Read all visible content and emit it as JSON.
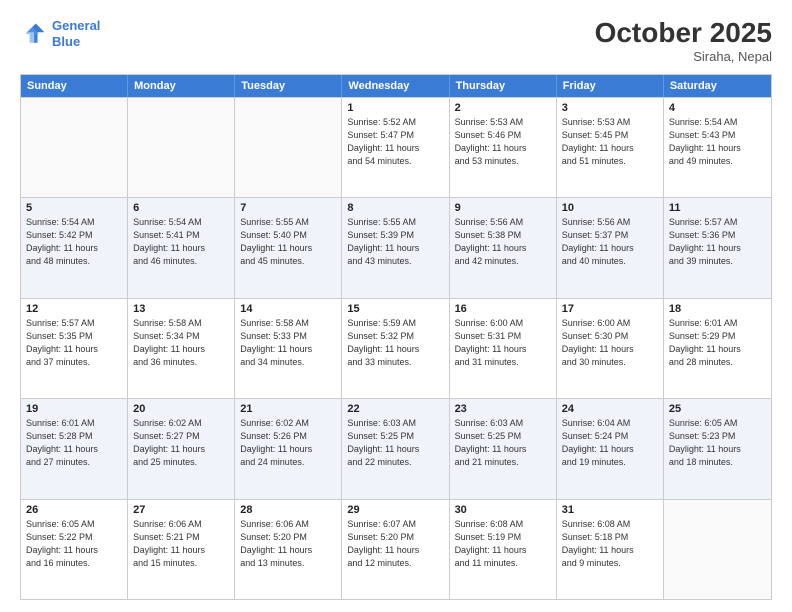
{
  "header": {
    "logo_line1": "General",
    "logo_line2": "Blue",
    "month": "October 2025",
    "location": "Siraha, Nepal"
  },
  "days_of_week": [
    "Sunday",
    "Monday",
    "Tuesday",
    "Wednesday",
    "Thursday",
    "Friday",
    "Saturday"
  ],
  "weeks": [
    [
      {
        "day": "",
        "text": "",
        "shaded": false
      },
      {
        "day": "",
        "text": "",
        "shaded": false
      },
      {
        "day": "",
        "text": "",
        "shaded": false
      },
      {
        "day": "1",
        "text": "Sunrise: 5:52 AM\nSunset: 5:47 PM\nDaylight: 11 hours\nand 54 minutes.",
        "shaded": false
      },
      {
        "day": "2",
        "text": "Sunrise: 5:53 AM\nSunset: 5:46 PM\nDaylight: 11 hours\nand 53 minutes.",
        "shaded": false
      },
      {
        "day": "3",
        "text": "Sunrise: 5:53 AM\nSunset: 5:45 PM\nDaylight: 11 hours\nand 51 minutes.",
        "shaded": false
      },
      {
        "day": "4",
        "text": "Sunrise: 5:54 AM\nSunset: 5:43 PM\nDaylight: 11 hours\nand 49 minutes.",
        "shaded": false
      }
    ],
    [
      {
        "day": "5",
        "text": "Sunrise: 5:54 AM\nSunset: 5:42 PM\nDaylight: 11 hours\nand 48 minutes.",
        "shaded": true
      },
      {
        "day": "6",
        "text": "Sunrise: 5:54 AM\nSunset: 5:41 PM\nDaylight: 11 hours\nand 46 minutes.",
        "shaded": true
      },
      {
        "day": "7",
        "text": "Sunrise: 5:55 AM\nSunset: 5:40 PM\nDaylight: 11 hours\nand 45 minutes.",
        "shaded": true
      },
      {
        "day": "8",
        "text": "Sunrise: 5:55 AM\nSunset: 5:39 PM\nDaylight: 11 hours\nand 43 minutes.",
        "shaded": true
      },
      {
        "day": "9",
        "text": "Sunrise: 5:56 AM\nSunset: 5:38 PM\nDaylight: 11 hours\nand 42 minutes.",
        "shaded": true
      },
      {
        "day": "10",
        "text": "Sunrise: 5:56 AM\nSunset: 5:37 PM\nDaylight: 11 hours\nand 40 minutes.",
        "shaded": true
      },
      {
        "day": "11",
        "text": "Sunrise: 5:57 AM\nSunset: 5:36 PM\nDaylight: 11 hours\nand 39 minutes.",
        "shaded": true
      }
    ],
    [
      {
        "day": "12",
        "text": "Sunrise: 5:57 AM\nSunset: 5:35 PM\nDaylight: 11 hours\nand 37 minutes.",
        "shaded": false
      },
      {
        "day": "13",
        "text": "Sunrise: 5:58 AM\nSunset: 5:34 PM\nDaylight: 11 hours\nand 36 minutes.",
        "shaded": false
      },
      {
        "day": "14",
        "text": "Sunrise: 5:58 AM\nSunset: 5:33 PM\nDaylight: 11 hours\nand 34 minutes.",
        "shaded": false
      },
      {
        "day": "15",
        "text": "Sunrise: 5:59 AM\nSunset: 5:32 PM\nDaylight: 11 hours\nand 33 minutes.",
        "shaded": false
      },
      {
        "day": "16",
        "text": "Sunrise: 6:00 AM\nSunset: 5:31 PM\nDaylight: 11 hours\nand 31 minutes.",
        "shaded": false
      },
      {
        "day": "17",
        "text": "Sunrise: 6:00 AM\nSunset: 5:30 PM\nDaylight: 11 hours\nand 30 minutes.",
        "shaded": false
      },
      {
        "day": "18",
        "text": "Sunrise: 6:01 AM\nSunset: 5:29 PM\nDaylight: 11 hours\nand 28 minutes.",
        "shaded": false
      }
    ],
    [
      {
        "day": "19",
        "text": "Sunrise: 6:01 AM\nSunset: 5:28 PM\nDaylight: 11 hours\nand 27 minutes.",
        "shaded": true
      },
      {
        "day": "20",
        "text": "Sunrise: 6:02 AM\nSunset: 5:27 PM\nDaylight: 11 hours\nand 25 minutes.",
        "shaded": true
      },
      {
        "day": "21",
        "text": "Sunrise: 6:02 AM\nSunset: 5:26 PM\nDaylight: 11 hours\nand 24 minutes.",
        "shaded": true
      },
      {
        "day": "22",
        "text": "Sunrise: 6:03 AM\nSunset: 5:25 PM\nDaylight: 11 hours\nand 22 minutes.",
        "shaded": true
      },
      {
        "day": "23",
        "text": "Sunrise: 6:03 AM\nSunset: 5:25 PM\nDaylight: 11 hours\nand 21 minutes.",
        "shaded": true
      },
      {
        "day": "24",
        "text": "Sunrise: 6:04 AM\nSunset: 5:24 PM\nDaylight: 11 hours\nand 19 minutes.",
        "shaded": true
      },
      {
        "day": "25",
        "text": "Sunrise: 6:05 AM\nSunset: 5:23 PM\nDaylight: 11 hours\nand 18 minutes.",
        "shaded": true
      }
    ],
    [
      {
        "day": "26",
        "text": "Sunrise: 6:05 AM\nSunset: 5:22 PM\nDaylight: 11 hours\nand 16 minutes.",
        "shaded": false
      },
      {
        "day": "27",
        "text": "Sunrise: 6:06 AM\nSunset: 5:21 PM\nDaylight: 11 hours\nand 15 minutes.",
        "shaded": false
      },
      {
        "day": "28",
        "text": "Sunrise: 6:06 AM\nSunset: 5:20 PM\nDaylight: 11 hours\nand 13 minutes.",
        "shaded": false
      },
      {
        "day": "29",
        "text": "Sunrise: 6:07 AM\nSunset: 5:20 PM\nDaylight: 11 hours\nand 12 minutes.",
        "shaded": false
      },
      {
        "day": "30",
        "text": "Sunrise: 6:08 AM\nSunset: 5:19 PM\nDaylight: 11 hours\nand 11 minutes.",
        "shaded": false
      },
      {
        "day": "31",
        "text": "Sunrise: 6:08 AM\nSunset: 5:18 PM\nDaylight: 11 hours\nand 9 minutes.",
        "shaded": false
      },
      {
        "day": "",
        "text": "",
        "shaded": false
      }
    ]
  ]
}
